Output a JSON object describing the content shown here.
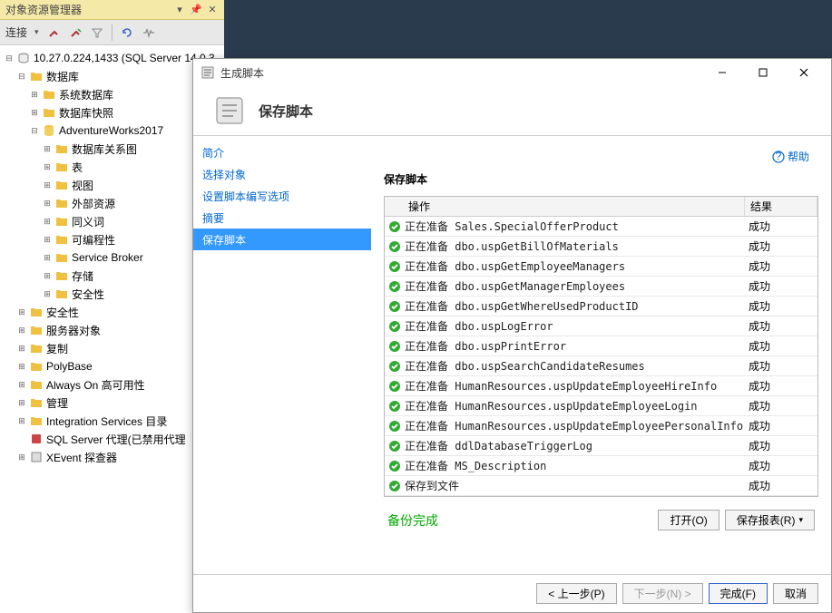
{
  "explorer": {
    "title": "对象资源管理器",
    "connect": "连接",
    "server": "10.27.0.224,1433 (SQL Server 14.0.3",
    "nodes": {
      "databases": "数据库",
      "sysdb": "系统数据库",
      "snapshots": "数据库快照",
      "aw": "AdventureWorks2017",
      "diagrams": "数据库关系图",
      "tables": "表",
      "views": "视图",
      "extres": "外部资源",
      "synonyms": "同义词",
      "programmability": "可编程性",
      "servicebroker": "Service Broker",
      "storage": "存储",
      "security_db": "安全性",
      "security": "安全性",
      "serverobjects": "服务器对象",
      "replication": "复制",
      "polybase": "PolyBase",
      "alwayson": "Always On 高可用性",
      "management": "管理",
      "isc": "Integration Services 目录",
      "agent": "SQL Server 代理(已禁用代理",
      "xevent": "XEvent 探查器"
    }
  },
  "dialog": {
    "window_title": "生成脚本",
    "header_title": "保存脚本",
    "help": "帮助",
    "side": {
      "intro": "简介",
      "select": "选择对象",
      "options": "设置脚本编写选项",
      "summary": "摘要",
      "save": "保存脚本"
    },
    "main_title": "保存脚本",
    "grid": {
      "col_op": "操作",
      "col_result": "结果",
      "rows": [
        {
          "op": "正在准备 Sales.SpecialOfferProduct",
          "res": "成功"
        },
        {
          "op": "正在准备 dbo.uspGetBillOfMaterials",
          "res": "成功"
        },
        {
          "op": "正在准备 dbo.uspGetEmployeeManagers",
          "res": "成功"
        },
        {
          "op": "正在准备 dbo.uspGetManagerEmployees",
          "res": "成功"
        },
        {
          "op": "正在准备 dbo.uspGetWhereUsedProductID",
          "res": "成功"
        },
        {
          "op": "正在准备 dbo.uspLogError",
          "res": "成功"
        },
        {
          "op": "正在准备 dbo.uspPrintError",
          "res": "成功"
        },
        {
          "op": "正在准备 dbo.uspSearchCandidateResumes",
          "res": "成功"
        },
        {
          "op": "正在准备 HumanResources.uspUpdateEmployeeHireInfo",
          "res": "成功"
        },
        {
          "op": "正在准备 HumanResources.uspUpdateEmployeeLogin",
          "res": "成功"
        },
        {
          "op": "正在准备 HumanResources.uspUpdateEmployeePersonalInfo",
          "res": "成功"
        },
        {
          "op": "正在准备 ddlDatabaseTriggerLog",
          "res": "成功"
        },
        {
          "op": "正在准备 MS_Description",
          "res": "成功"
        },
        {
          "op": "保存到文件",
          "res": "成功"
        }
      ]
    },
    "status": "备份完成",
    "buttons": {
      "open": "打开(O)",
      "save_report": "保存报表(R)",
      "prev": "< 上一步(P)",
      "next": "下一步(N) >",
      "finish": "完成(F)",
      "cancel": "取消"
    }
  }
}
